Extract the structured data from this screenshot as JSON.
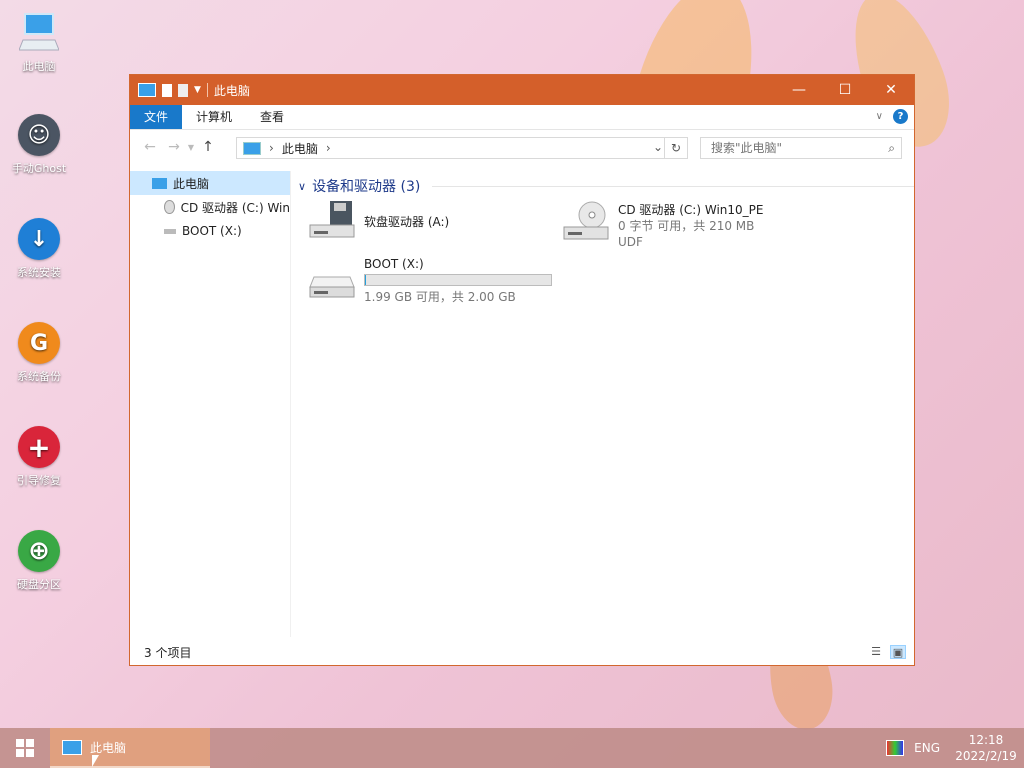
{
  "desktop": {
    "icons": [
      {
        "label": "此电脑",
        "icon": "computer-icon"
      },
      {
        "label": "手动Ghost",
        "icon": "ghost-icon",
        "color": "#4b5563"
      },
      {
        "label": "系统安装",
        "icon": "download-arrow-icon",
        "color": "#1f7fd6"
      },
      {
        "label": "系统备份",
        "icon": "g-letter-icon",
        "color": "#f08a1c"
      },
      {
        "label": "引导修复",
        "icon": "plus-icon",
        "color": "#d9253a"
      },
      {
        "label": "硬盘分区",
        "icon": "partition-icon",
        "color": "#39a845"
      }
    ]
  },
  "window": {
    "title": "此电脑",
    "accent": "#d45f2a",
    "controls": {
      "minimize": "—",
      "maximize": "☐",
      "close": "✕"
    },
    "ribbon": {
      "tabs": [
        {
          "label": "文件",
          "active": true
        },
        {
          "label": "计算机",
          "active": false
        },
        {
          "label": "查看",
          "active": false
        }
      ],
      "help": "?"
    },
    "address": {
      "crumb": "此电脑"
    },
    "search": {
      "placeholder": "搜索\"此电脑\""
    },
    "nav_pane": [
      {
        "label": "此电脑",
        "selected": true
      },
      {
        "label": "CD 驱动器 (C:) Win"
      },
      {
        "label": "BOOT (X:)"
      }
    ],
    "group": {
      "title": "设备和驱动器 (3)"
    },
    "drives": [
      {
        "name": "软盘驱动器 (A:)"
      },
      {
        "name": "CD 驱动器 (C:) Win10_PE",
        "line1": "0 字节 可用，共 210 MB",
        "line2": "UDF"
      },
      {
        "name": "BOOT (X:)",
        "usage": "1.99 GB 可用，共 2.00 GB",
        "used_fraction": 0.005
      }
    ],
    "status": {
      "items_count": "3 个项目"
    }
  },
  "taskbar": {
    "app_label": "此电脑",
    "language": "ENG",
    "time": "12:18",
    "date": "2022/2/19"
  }
}
